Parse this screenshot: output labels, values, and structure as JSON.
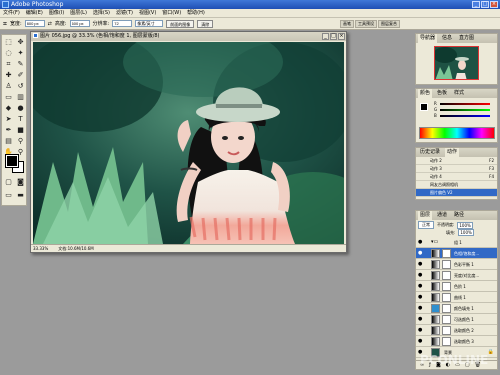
{
  "app": {
    "title": "Adobe Photoshop"
  },
  "menubar": {
    "items": [
      "文件(F)",
      "编辑(E)",
      "图像(I)",
      "图层(L)",
      "选择(S)",
      "滤镜(T)",
      "视图(V)",
      "窗口(W)",
      "帮助(H)"
    ]
  },
  "options": {
    "width_label": "宽度:",
    "width_value": "800 px",
    "height_label": "高度:",
    "height_value": "600 px",
    "res_label": "分辨率:",
    "res_value": "72",
    "unit": "像素/英寸",
    "front_image_btn": "前面的图像",
    "clear_btn": "清除"
  },
  "right_tabs": [
    "画笔",
    "工具预设",
    "图层复合"
  ],
  "document": {
    "title": "图片 056.jpg @ 33.3% (色相/饱和度 1, 图层蒙版/8)",
    "zoom": "33.33%",
    "doc_size": "文档:10.6M/10.6M"
  },
  "navigator": {
    "tabs": [
      "导航器",
      "信息",
      "直方图"
    ]
  },
  "color_panel": {
    "tabs": [
      "颜色",
      "色板",
      "样式"
    ],
    "r_label": "R",
    "g_label": "G",
    "b_label": "B"
  },
  "history": {
    "tabs": [
      "历史记录",
      "动作"
    ],
    "rows": [
      {
        "label": "动作 2",
        "key": "F2"
      },
      {
        "label": "动作 3",
        "key": "F3"
      },
      {
        "label": "动作 4",
        "key": "F4"
      },
      {
        "label": "网友古调照相机",
        "key": ""
      },
      {
        "label": "图片偏色 V2",
        "key": ""
      },
      {
        "label": "动作 5",
        "key": "F5"
      }
    ]
  },
  "layers": {
    "tabs": [
      "图层",
      "通道",
      "路径"
    ],
    "blend_mode": "正常",
    "opacity_label": "不透明度:",
    "opacity": "100%",
    "fill_label": "填充:",
    "fill": "100%",
    "group_name": "组 1",
    "rows": [
      "色相/饱和度...",
      "色彩平衡 1",
      "亮度/对比度...",
      "色阶 1",
      "曲线 1",
      "颜色填充 1",
      "可选颜色 1",
      "选取颜色 2",
      "选取颜色 3",
      "背景"
    ]
  },
  "watermark": "PCONLINE"
}
